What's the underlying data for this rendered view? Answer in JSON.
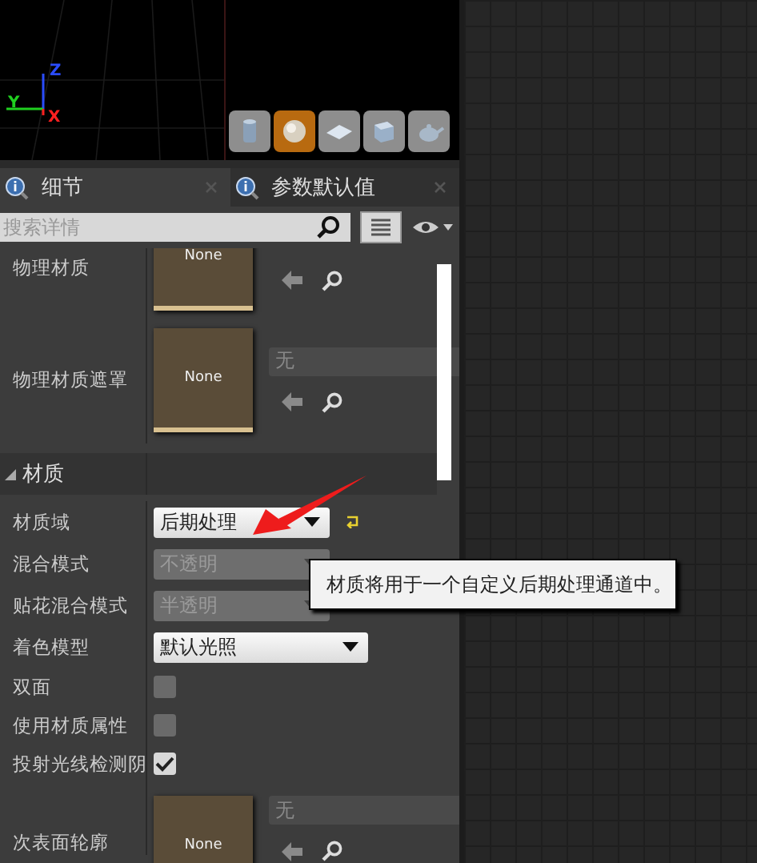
{
  "viewport": {
    "axes": [
      {
        "label": "Z",
        "kind": "z"
      },
      {
        "label": "Y",
        "kind": "y"
      },
      {
        "label": "X",
        "kind": "x"
      }
    ],
    "preview_shapes": [
      {
        "kind": "cylinder",
        "selected": false
      },
      {
        "kind": "sphere",
        "selected": true
      },
      {
        "kind": "plane",
        "selected": false
      },
      {
        "kind": "cube",
        "selected": false
      },
      {
        "kind": "teapot",
        "selected": false
      }
    ]
  },
  "tabs": [
    {
      "label": "细节",
      "selected": true
    },
    {
      "label": "参数默认值",
      "selected": false
    }
  ],
  "search": {
    "placeholder": "搜索详情"
  },
  "sections": [
    {
      "kind": "rows",
      "rows": [
        {
          "kind": "asset",
          "label": "物理材质",
          "thumbnail": "None"
        },
        {
          "kind": "asset",
          "label": "物理材质遮罩",
          "thumbnail": "None",
          "picker": "无"
        }
      ]
    },
    {
      "kind": "category",
      "label": "材质",
      "expanded": true,
      "rows": [
        {
          "kind": "dropdown",
          "label": "材质域",
          "value": "后期处理",
          "disabled": false,
          "modified": true
        },
        {
          "kind": "dropdown",
          "label": "混合模式",
          "value": "不透明",
          "disabled": true,
          "modified": false
        },
        {
          "kind": "dropdown",
          "label": "贴花混合模式",
          "value": "半透明",
          "disabled": true,
          "modified": false
        },
        {
          "kind": "dropdown",
          "label": "着色模型",
          "value": "默认光照",
          "disabled": false,
          "modified": false
        },
        {
          "kind": "checkbox",
          "label": "双面",
          "checked": false
        },
        {
          "kind": "checkbox",
          "label": "使用材质属性",
          "checked": false
        },
        {
          "kind": "checkbox",
          "label": "投射光线检测阴",
          "checked": true
        },
        {
          "kind": "asset",
          "label": "次表面轮廓",
          "thumbnail": "None",
          "picker": "无"
        }
      ]
    }
  ],
  "tooltip": {
    "text": "材质将用于一个自定义后期处理通道中。"
  }
}
